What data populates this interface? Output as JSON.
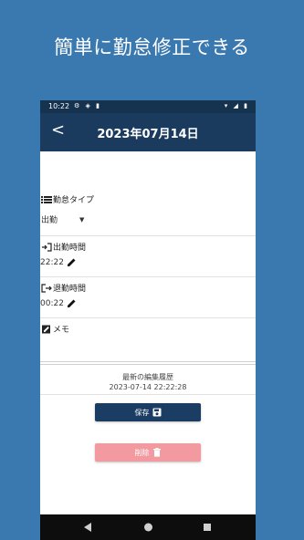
{
  "promo": {
    "title": "簡単に勤怠修正できる"
  },
  "status_bar": {
    "time": "10:22"
  },
  "app_bar": {
    "title": "2023年07月14日"
  },
  "attendance_type": {
    "label": "勤怠タイプ",
    "value": "出勤"
  },
  "clock_in": {
    "label": "出勤時間",
    "value": "22:22"
  },
  "clock_out": {
    "label": "退勤時間",
    "value": "00:22"
  },
  "memo": {
    "label": "メモ"
  },
  "history": {
    "title": "最新の編集履歴",
    "timestamp": "2023-07-14 22:22:28"
  },
  "buttons": {
    "save_label": "保存",
    "delete_label": "削除"
  },
  "colors": {
    "background": "#3a78b0",
    "app_bar": "#1b3b5e",
    "save_button": "#1c3d63",
    "delete_button": "#f39aa1"
  }
}
